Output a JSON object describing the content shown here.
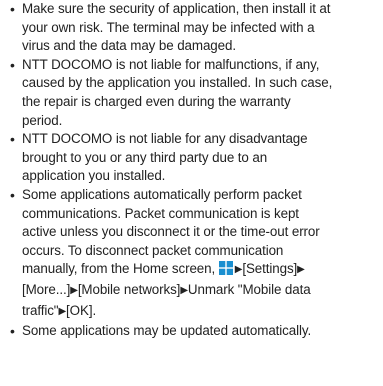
{
  "bullets": [
    {
      "lines": [
        "Make sure the security of application, then install it at",
        "your own risk. The terminal may be infected with a",
        "virus and the data may be damaged."
      ]
    },
    {
      "lines": [
        "NTT DOCOMO is not liable for malfunctions, if any,",
        "caused by the application you installed. In such case,",
        "the repair is charged even during the warranty",
        "period."
      ]
    },
    {
      "lines": [
        "NTT DOCOMO is not liable for any disadvantage",
        "brought to you or any third party due to an",
        "application you installed."
      ]
    },
    {
      "lines": [
        "Some applications automatically perform packet",
        "communications. Packet communication is kept",
        "active unless you disconnect it or the time-out error",
        "occurs. To disconnect packet communication"
      ],
      "nav": {
        "prefix": "manually, from the Home screen,",
        "settings": "[Settings]",
        "more": "[More...]",
        "mobile_networks": "[Mobile networks]",
        "unmark": "Unmark \"Mobile data",
        "traffic": "traffic\"",
        "ok": "[OK]",
        "end": "."
      }
    },
    {
      "lines": [
        "Some applications may be updated automatically."
      ]
    }
  ],
  "symbols": {
    "bullet": "•",
    "arrow": "▶"
  },
  "colors": {
    "text": "#222222",
    "apps_icon": "#1a8fd0"
  },
  "icons": {
    "apps": "apps-grid-icon"
  }
}
